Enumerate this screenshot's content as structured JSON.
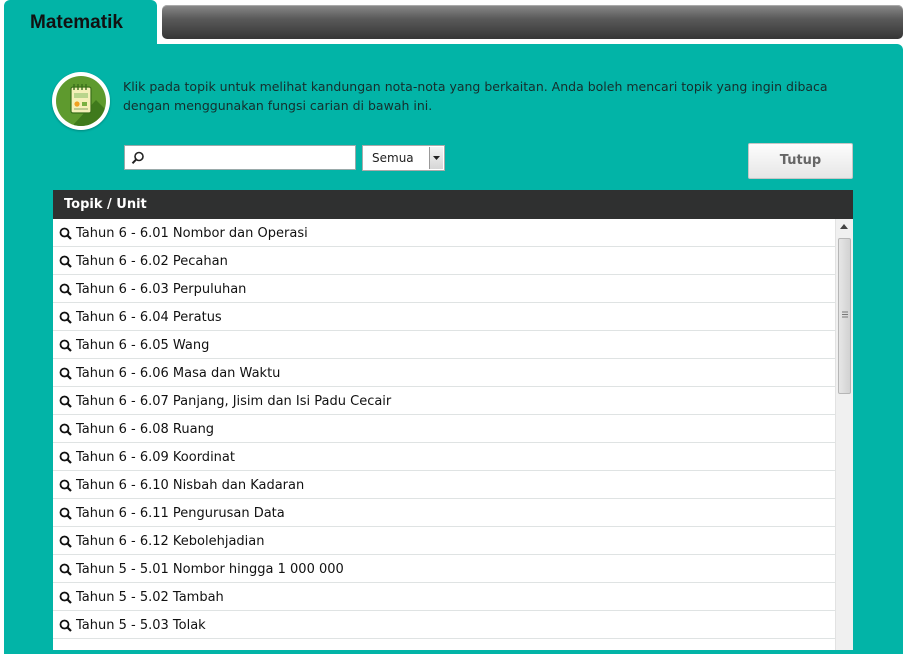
{
  "tab": {
    "label": "Matematik"
  },
  "intro": {
    "line1": "Klik pada topik untuk melihat kandungan nota-nota yang berkaitan. Anda boleh mencari topik yang ingin dibaca",
    "line2": "dengan menggunakan fungsi carian di bawah ini."
  },
  "search": {
    "value": "",
    "placeholder": ""
  },
  "filter": {
    "selected": "Semua"
  },
  "close_button": {
    "label": "Tutup"
  },
  "table": {
    "header": "Topik / Unit",
    "rows": [
      "Tahun 6 - 6.01 Nombor dan Operasi",
      "Tahun 6 - 6.02 Pecahan",
      "Tahun 6 - 6.03 Perpuluhan",
      "Tahun 6 - 6.04 Peratus",
      "Tahun 6 - 6.05 Wang",
      "Tahun 6 - 6.06 Masa dan Waktu",
      "Tahun 6 - 6.07 Panjang, Jisim dan Isi Padu Cecair",
      "Tahun 6 - 6.08 Ruang",
      "Tahun 6 - 6.09 Koordinat",
      "Tahun 6 - 6.10 Nisbah dan Kadaran",
      "Tahun 6 - 6.11 Pengurusan Data",
      "Tahun 6 - 6.12 Kebolehjadian",
      "Tahun 5 - 5.01 Nombor hingga 1 000 000",
      "Tahun 5 - 5.02 Tambah",
      "Tahun 5 - 5.03 Tolak"
    ]
  },
  "colors": {
    "panel": "#02b4a7",
    "header_bar": "#2f3030",
    "logo_green": "#5e9a2e"
  },
  "icons": {
    "row": "search-icon",
    "logo": "notes-icon"
  }
}
